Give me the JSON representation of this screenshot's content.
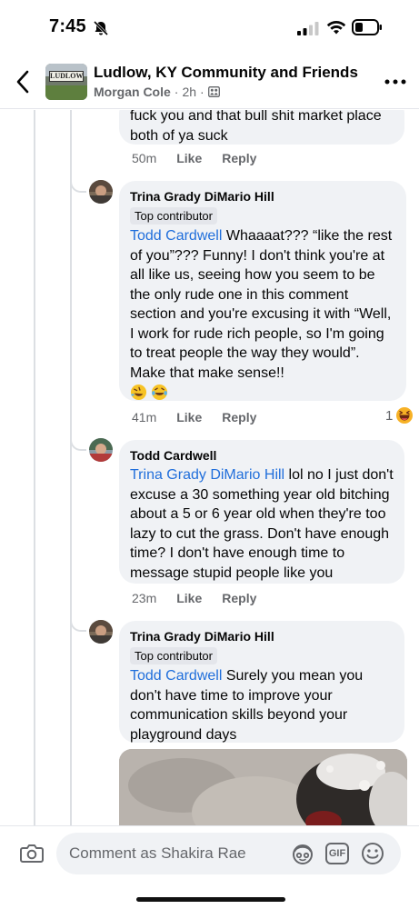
{
  "status_bar": {
    "time": "7:45"
  },
  "header": {
    "group_name": "Ludlow, KY Community and Friends",
    "author": "Morgan Cole",
    "age": "2h",
    "avatar_sign_text": "LUDLOW"
  },
  "comments": [
    {
      "id": "c0",
      "text_partial": "fuck you and that bull shit market place both of ya suck",
      "time": "50m",
      "like_label": "Like",
      "reply_label": "Reply"
    },
    {
      "id": "c1",
      "author": "Trina Grady DiMario Hill",
      "badge": "Top contributor",
      "mention": "Todd Cardwell",
      "text": " Whaaaat??? “like the rest of you”??? Funny! I don't think you're at all like us, seeing how you seem to be the only rude one in this comment section and you're excusing it with “Well, I work for rude rich people, so I'm going to treat people the way they would”. Make that make sense!!",
      "emojis": [
        "rofl-emoji",
        "laughing-tears-emoji"
      ],
      "time": "41m",
      "like_label": "Like",
      "reply_label": "Reply",
      "reaction_count": "1",
      "reaction_icon": "haha-reaction-icon"
    },
    {
      "id": "c2",
      "author": "Todd Cardwell",
      "mention": "Trina Grady DiMario Hill",
      "text": " lol no I just don't excuse a 30 something year old bitching about a 5 or 6 year old when they're too lazy to cut the grass.  Don't have enough time? I don't have enough time to message stupid people like you",
      "time": "23m",
      "like_label": "Like",
      "reply_label": "Reply"
    },
    {
      "id": "c3",
      "author": "Trina Grady DiMario Hill",
      "badge": "Top contributor",
      "mention": "Todd Cardwell",
      "text": " Surely you mean you don't have time to improve your communication skills beyond your playground days"
    }
  ],
  "composer": {
    "placeholder": "Comment as Shakira Rae",
    "icons": [
      "camera-icon",
      "avatar-sticker-icon",
      "gif-icon",
      "emoji-icon"
    ],
    "gif_label": "GIF"
  },
  "colors": {
    "mention": "#216fdb",
    "bubble": "#f0f2f5",
    "meta": "#65676b"
  }
}
